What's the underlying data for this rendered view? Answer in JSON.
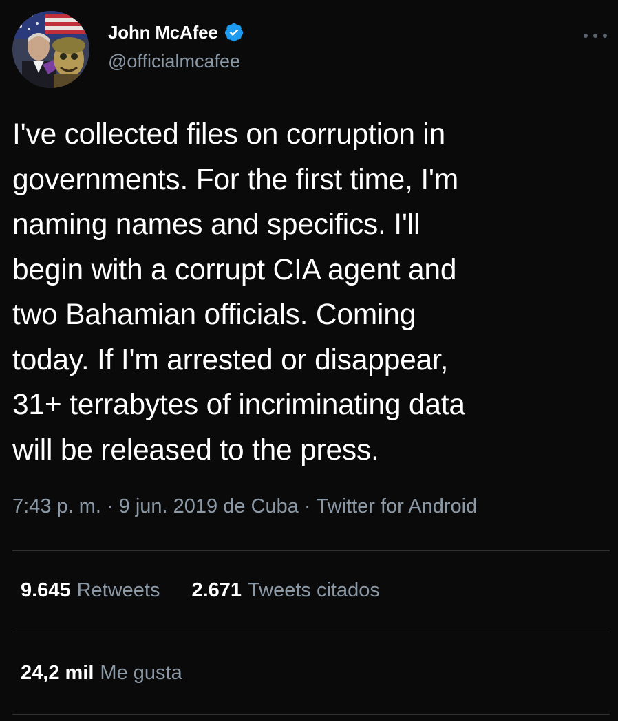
{
  "author": {
    "display_name": "John McAfee",
    "handle": "@officialmcafee",
    "verified": true,
    "avatar_icon": "profile-photo-avatar"
  },
  "tweet": {
    "text": "I've collected files on corruption in\ngovernments. For the first time, I'm\nnaming names and specifics. I'll\nbegin with a corrupt CIA agent and\ntwo Bahamian officials. Coming\ntoday. If I'm arrested or disappear,\n31+ terrabytes of incriminating data\nwill be released to the press.",
    "time": "7:43 p. m.",
    "date_location": "9 jun. 2019 de Cuba",
    "client": "Twitter for Android",
    "separator": "·"
  },
  "stats": {
    "retweets_count": "9.645",
    "retweets_label": "Retweets",
    "quotes_count": "2.671",
    "quotes_label": "Tweets citados",
    "likes_count": "24,2 mil",
    "likes_label": "Me gusta"
  },
  "colors": {
    "background": "#0a0a0a",
    "primary_text": "#ffffff",
    "secondary_text": "#8b98a5",
    "verified_badge": "#1d9bf0",
    "divider": "#2f3336"
  },
  "icons": {
    "more": "more-horizontal-icon",
    "verified": "verified-badge-icon"
  }
}
